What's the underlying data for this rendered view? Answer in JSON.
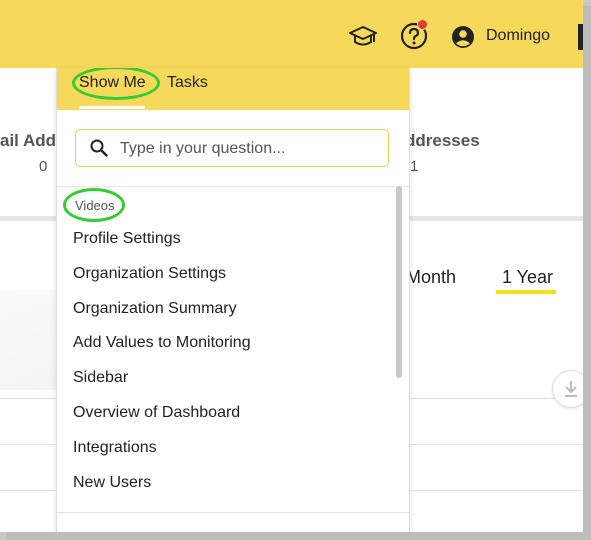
{
  "header": {
    "username": "Domingo",
    "icons": [
      "graduation-cap-icon",
      "help-icon",
      "user-account-icon"
    ],
    "notification_color": "#e53935",
    "brand_color": "#f6d95a"
  },
  "background_page": {
    "stat_left_label": "ail Add",
    "stat_left_value": "0",
    "stat_right_label": "ddresses",
    "stat_right_value": "1",
    "period_tabs": [
      "Month",
      "1 Year"
    ],
    "active_period": "1 Year"
  },
  "help_panel": {
    "tabs": [
      {
        "label": "Show Me",
        "active": true
      },
      {
        "label": "Tasks",
        "active": false
      }
    ],
    "search": {
      "placeholder": "Type in your question...",
      "value": ""
    },
    "section_label": "Videos",
    "items": [
      "Profile Settings",
      "Organization Settings",
      "Organization Summary",
      "Add Values to Monitoring",
      "Sidebar",
      "Overview of Dashboard",
      "Integrations",
      "New Users"
    ],
    "highlight_color": "#33cc33"
  }
}
